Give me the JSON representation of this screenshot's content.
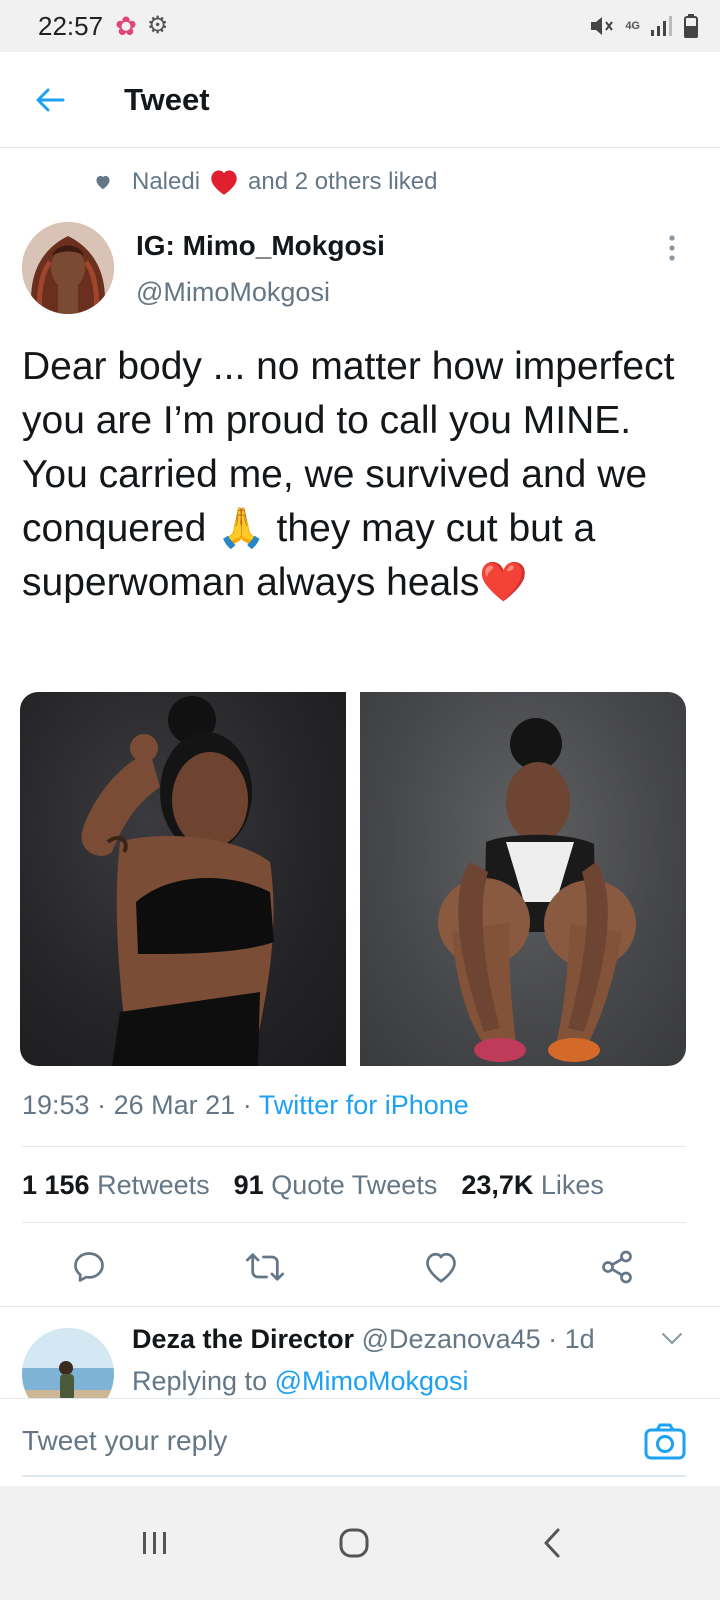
{
  "status_bar": {
    "time": "22:57",
    "network": "4G"
  },
  "header": {
    "title": "Tweet"
  },
  "social_context": {
    "liker": "Naledi",
    "rest": "and 2 others liked"
  },
  "tweet": {
    "author_name": "IG: Mimo_Mokgosi",
    "author_handle": "@MimoMokgosi",
    "text": "Dear body ... no matter how imperfect you are I’m proud to call you MINE.  You carried me, we survived and we conquered 🙏 they may cut but a superwoman always heals❤️",
    "time": "19:53",
    "date": "26 Mar 21",
    "source": "Twitter for iPhone",
    "separator": "·"
  },
  "stats": {
    "retweets_count": "1 156",
    "retweets_label": "Retweets",
    "quotes_count": "91",
    "quotes_label": "Quote Tweets",
    "likes_count": "23,7K",
    "likes_label": "Likes"
  },
  "reply": {
    "name": "Deza the Director",
    "handle": "@Dezanova45",
    "time": "1d",
    "replying_prefix": "Replying to",
    "replying_to": "@MimoMokgosi"
  },
  "compose": {
    "placeholder": "Tweet your reply"
  },
  "colors": {
    "accent": "#1da1f2",
    "like_red": "#e0245e",
    "secondary_text": "#657786"
  },
  "icons": [
    "flower-icon",
    "gear-icon",
    "mute-icon",
    "signal-icon",
    "battery-icon",
    "back-arrow-icon",
    "heart-icon",
    "more-vertical-icon",
    "reply-icon",
    "retweet-icon",
    "like-icon",
    "share-icon",
    "chevron-down-icon",
    "camera-icon",
    "recents-icon",
    "home-icon",
    "back-icon"
  ]
}
